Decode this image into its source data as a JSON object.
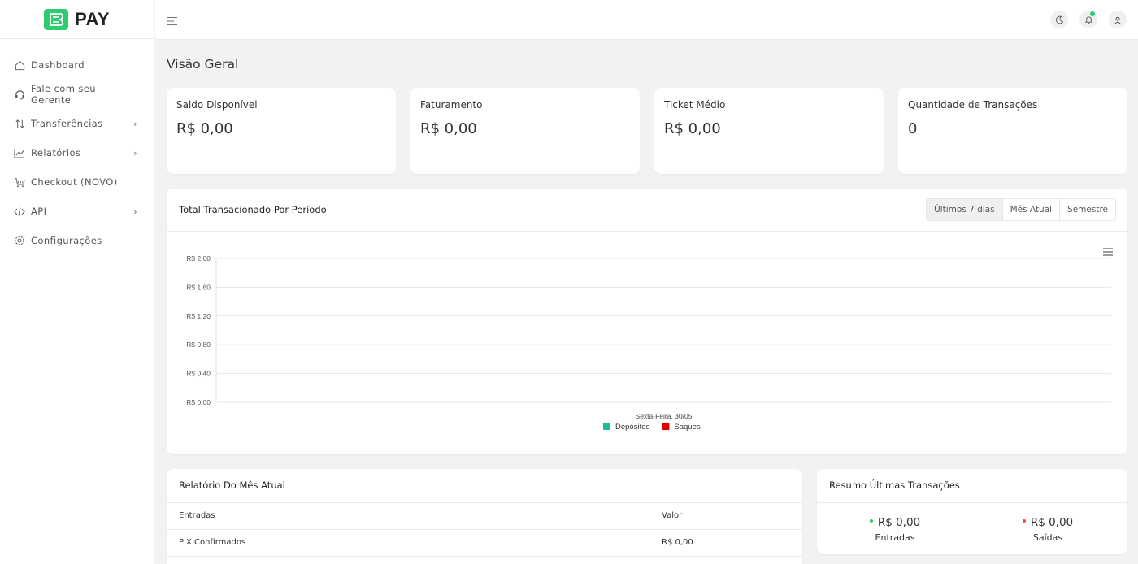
{
  "brand": {
    "name": "PAY",
    "accent": "#2ecc71"
  },
  "sidebar": {
    "items": [
      {
        "label": "Dashboard",
        "icon": "home-icon",
        "has_submenu": false
      },
      {
        "label": "Fale com seu Gerente",
        "icon": "headset-icon",
        "has_submenu": false
      },
      {
        "label": "Transferências",
        "icon": "transfer-icon",
        "has_submenu": true
      },
      {
        "label": "Relatórios",
        "icon": "chart-line-icon",
        "has_submenu": true
      },
      {
        "label": "Checkout (NOVO)",
        "icon": "cart-icon",
        "has_submenu": false
      },
      {
        "label": "API",
        "icon": "code-icon",
        "has_submenu": true
      },
      {
        "label": "Configurações",
        "icon": "gear-icon",
        "has_submenu": false
      }
    ]
  },
  "topbar": {
    "icons": [
      "menu-icon",
      "moon-icon",
      "bell-icon",
      "user-icon"
    ]
  },
  "page": {
    "title": "Visão Geral"
  },
  "stats": [
    {
      "label": "Saldo Disponível",
      "value": "R$ 0,00"
    },
    {
      "label": "Faturamento",
      "value": "R$ 0,00"
    },
    {
      "label": "Ticket Médio",
      "value": "R$ 0,00"
    },
    {
      "label": "Quantidade de Transações",
      "value": "0"
    }
  ],
  "chart_card": {
    "title": "Total Transacionado Por Período",
    "tabs": [
      "Últimos 7 dias",
      "Mês Atual",
      "Semestre"
    ],
    "active_tab": "Últimos 7 dias"
  },
  "chart_data": {
    "type": "line",
    "title": "",
    "xlabel": "",
    "ylabel": "",
    "categories": [
      "Sexta-Feira, 30/05"
    ],
    "ylim": [
      0,
      2
    ],
    "y_ticks": [
      "R$ 0,00",
      "R$ 0,40",
      "R$ 0,80",
      "R$ 1,20",
      "R$ 1,60",
      "R$ 2,00"
    ],
    "series": [
      {
        "name": "Depósitos",
        "color": "#1abc9c",
        "values": [
          0
        ]
      },
      {
        "name": "Saques",
        "color": "#e00000",
        "values": [
          0
        ]
      }
    ],
    "grid": true,
    "legend": "bottom-center"
  },
  "report": {
    "title": "Relatório Do Mês Atual",
    "columns": [
      "Entradas",
      "Valor"
    ],
    "rows": [
      [
        "PIX Confirmados",
        "R$ 0,00"
      ]
    ]
  },
  "summary": {
    "title": "Resumo Últimas Transações",
    "items": [
      {
        "value": "R$ 0,00",
        "label": "Entradas",
        "color": "#2ecc71"
      },
      {
        "value": "R$ 0,00",
        "label": "Saídas",
        "color": "#e74c3c"
      }
    ]
  }
}
